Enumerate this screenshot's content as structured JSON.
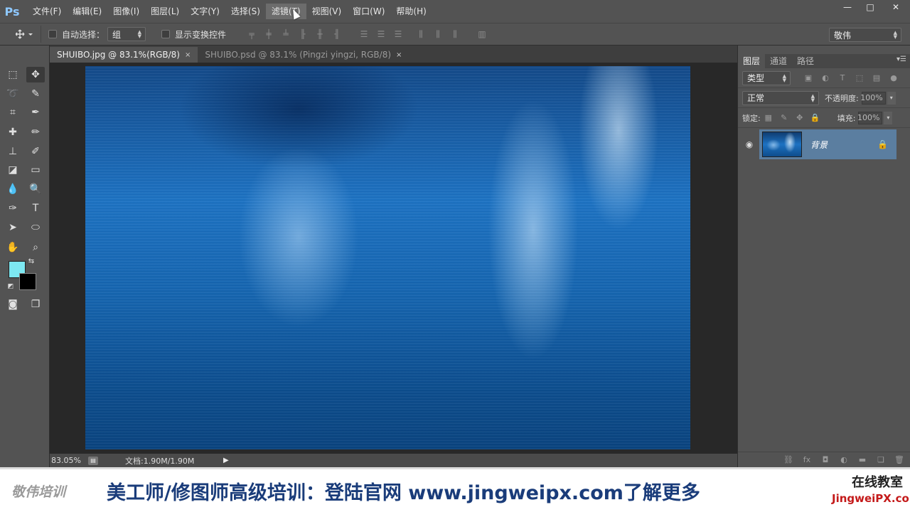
{
  "app": {
    "logo": "Ps"
  },
  "menu": [
    "文件(F)",
    "编辑(E)",
    "图像(I)",
    "图层(L)",
    "文字(Y)",
    "选择(S)",
    "滤镜(T)",
    "视图(V)",
    "窗口(W)",
    "帮助(H)"
  ],
  "menu_active_index": 6,
  "window_controls": {
    "minimize": "—",
    "maximize": "□",
    "close": "✕"
  },
  "options": {
    "auto_select_label": "自动选择：",
    "auto_select_value": "组",
    "show_transform_label": "显示变换控件",
    "workspace": "敬伟"
  },
  "tabs": [
    {
      "title": "SHUIBO.jpg @ 83.1%(RGB/8)",
      "active": true
    },
    {
      "title": "SHUIBO.psd @ 83.1% (Pingzi yingzi, RGB/8)",
      "active": false
    }
  ],
  "tab_close": "×",
  "status": {
    "zoom": "83.05%",
    "doc_info": "文档:1.90M/1.90M",
    "arrow": "▶"
  },
  "layers_panel": {
    "tabs": [
      "图层",
      "通道",
      "路径"
    ],
    "filter_type": "类型",
    "blend_mode": "正常",
    "opacity_label": "不透明度:",
    "opacity_value": "100%",
    "lock_label": "锁定:",
    "fill_label": "填充:",
    "fill_value": "100%",
    "layer": {
      "name": "背景"
    }
  },
  "banner": {
    "brand": "敬伟培训",
    "slogan": "美工师/修图师高级培训：登陆官网 www.jingweipx.com了解更多",
    "right_top": "在线教室",
    "right_bottom": "JingweiPX.com"
  },
  "colors": {
    "foreground": "#7de8f2",
    "background": "#000000",
    "layer_selected": "#5b7ea0",
    "slogan": "#1a3c7a"
  }
}
